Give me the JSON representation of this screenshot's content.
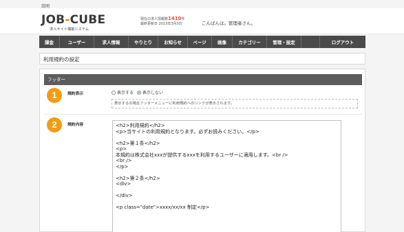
{
  "top_note": "説明",
  "header": {
    "logo_main": "JOB",
    "logo_dash": "-",
    "logo_cube": "CUBE",
    "logo_sub": "求人サイト構築システム",
    "stats_prefix": "現在の求人情報数",
    "stats_count": "1410",
    "stats_suffix": "件",
    "stats_updated": "最終更新日 2013年3月3日",
    "greeting": "こんばんは。管理者さん。"
  },
  "nav": {
    "items": [
      "課金",
      "ユーザー",
      "求人情報",
      "やりとり",
      "お知らせ",
      "ページ",
      "画像",
      "カテゴリー",
      "管理・設定",
      "",
      "ログアウト"
    ]
  },
  "page": {
    "title": "利用規約の設定"
  },
  "panel": {
    "header": "フッター",
    "row1": {
      "badge": "1",
      "label": "規約表示",
      "option_show": "表示する",
      "option_hide": "表示しない",
      "selected": "表示しない",
      "hint": "表示するの場合フッターメニューに利用規約へのリンクが表示されます。"
    },
    "row2": {
      "badge": "2",
      "label": "規約内容",
      "lines": [
        "<h2>利用規約</h2>",
        "<p>当サイトの利用規約となります。必ずお読みください。</p>",
        "",
        "<h2>第１条</h2>",
        "<p>",
        "本規約は株式会社xxxが提供するxxxを利用するユーザーに適用します。<br />",
        "<br />",
        "</p>",
        "",
        "<h2>第２条</h2>",
        "<div>",
        "",
        "</div>",
        "",
        "<p class=\"date\">xxxx/xx/xx 制定</p>"
      ]
    }
  }
}
